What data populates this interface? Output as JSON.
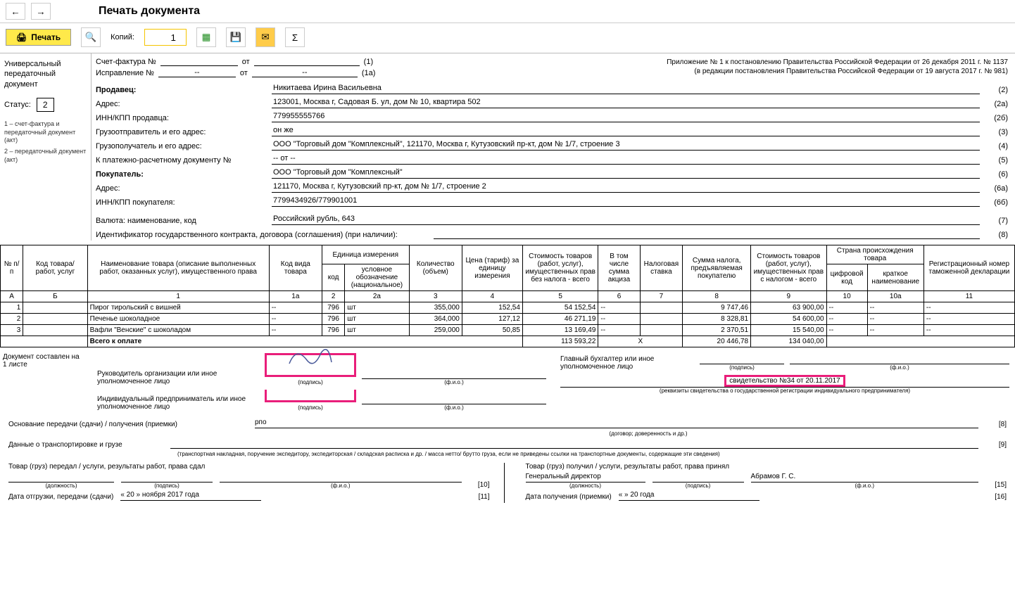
{
  "toolbar": {
    "title": "Печать документа",
    "print_label": "Печать",
    "copies_label": "Копий:",
    "copies_value": "1"
  },
  "sidebar": {
    "line1": "Универсальный",
    "line2": "передаточный",
    "line3": "документ",
    "status_label": "Статус:",
    "status_value": "2",
    "legend1": "1 – счет-фактура и передаточный документ (акт)",
    "legend2": "2 – передаточный документ (акт)"
  },
  "header": {
    "sf_label": "Счет-фактура №",
    "sf_from": "от",
    "sf_code": "(1)",
    "corr_label": "Исправление №",
    "corr_num": "--",
    "corr_from": "от",
    "corr_date": "--",
    "corr_code": "(1а)",
    "appendix1": "Приложение № 1 к постановлению Правительства Российской Федерации от 26 декабря 2011 г. № 1137",
    "appendix2": "(в редакции постановления Правительства Российской Федерации от 19 августа 2017 г. № 981)",
    "fields": [
      {
        "label": "Продавец:",
        "value": "Никитаева Ирина Васильевна",
        "code": "(2)",
        "bold": true
      },
      {
        "label": "Адрес:",
        "value": "123001, Москва г, Садовая Б. ул, дом № 10, квартира 502",
        "code": "(2а)"
      },
      {
        "label": "ИНН/КПП продавца:",
        "value": "779955555766",
        "code": "(2б)"
      },
      {
        "label": "Грузоотправитель и его адрес:",
        "value": "он же",
        "code": "(3)"
      },
      {
        "label": "Грузополучатель и его адрес:",
        "value": "ООО \"Торговый дом \"Комплексный\", 121170, Москва г, Кутузовский пр-кт, дом № 1/7, строение 3",
        "code": "(4)"
      },
      {
        "label": "К платежно-расчетному документу №",
        "value": "-- от --",
        "code": "(5)"
      },
      {
        "label": "Покупатель:",
        "value": "ООО \"Торговый дом \"Комплексный\"",
        "code": "(6)",
        "bold": true
      },
      {
        "label": "Адрес:",
        "value": "121170, Москва г, Кутузовский пр-кт, дом № 1/7, строение 2",
        "code": "(6а)"
      },
      {
        "label": "ИНН/КПП покупателя:",
        "value": "7799434926/779901001",
        "code": "(6б)"
      },
      {
        "label": "Валюта: наименование, код",
        "value": "Российский рубль, 643",
        "code": "(7)",
        "gap": true
      },
      {
        "label": "Идентификатор государственного контракта, договора (соглашения) (при наличии):",
        "value": "",
        "code": "(8)",
        "wide": true
      }
    ]
  },
  "table": {
    "h": {
      "num": "№ п/п",
      "code": "Код товара/ работ, услуг",
      "name": "Наименование товара (описание выполненных работ, оказанных услуг), имущественного права",
      "kind": "Код вида товара",
      "unit": "Единица измерения",
      "ucode": "код",
      "uname": "условное обозначение (национальное)",
      "qty": "Количество (объем)",
      "price": "Цена (тариф) за единицу измерения",
      "cost_notax": "Стоимость товаров (работ, услуг), имущественных прав без налога - всего",
      "excise": "В том числе сумма акциза",
      "rate": "Налоговая ставка",
      "tax": "Сумма налога, предъявляемая покупателю",
      "cost_tax": "Стоимость товаров (работ, услуг), имущественных прав с налогом - всего",
      "country": "Страна происхождения товара",
      "ccode": "цифровой код",
      "cname": "краткое наименование",
      "decl": "Регистрационный номер таможенной декларации",
      "cA": "А",
      "cB": "Б",
      "c1": "1",
      "c1a": "1а",
      "c2": "2",
      "c2a": "2а",
      "c3": "3",
      "c4": "4",
      "c5": "5",
      "c6": "6",
      "c7": "7",
      "c8": "8",
      "c9": "9",
      "c10": "10",
      "c10a": "10а",
      "c11": "11"
    },
    "rows": [
      {
        "n": "1",
        "name": "Пирог тирольский с вишней",
        "kind": "--",
        "uc": "796",
        "un": "шт",
        "qty": "355,000",
        "price": "152,54",
        "cost": "54 152,54",
        "ex": "--",
        "rate": "",
        "tax": "9 747,46",
        "total": "63 900,00",
        "cc": "--",
        "cn": "--",
        "decl": "--"
      },
      {
        "n": "2",
        "name": "Печенье шоколадное",
        "kind": "--",
        "uc": "796",
        "un": "шт",
        "qty": "364,000",
        "price": "127,12",
        "cost": "46 271,19",
        "ex": "--",
        "rate": "",
        "tax": "8 328,81",
        "total": "54 600,00",
        "cc": "--",
        "cn": "--",
        "decl": "--"
      },
      {
        "n": "3",
        "name": "Вафли \"Венские\" с шоколадом",
        "kind": "--",
        "uc": "796",
        "un": "шт",
        "qty": "259,000",
        "price": "50,85",
        "cost": "13 169,49",
        "ex": "--",
        "rate": "",
        "tax": "2 370,51",
        "total": "15 540,00",
        "cc": "--",
        "cn": "--",
        "decl": "--"
      }
    ],
    "total_label": "Всего к оплате",
    "t_cost": "113 593,22",
    "t_x": "Х",
    "t_tax": "20 446,78",
    "t_total": "134 040,00"
  },
  "sign": {
    "doc_on": "Документ составлен на",
    "sheets": "1 листе",
    "head": "Руководитель организации или иное уполномоченное лицо",
    "ip": "Индивидуальный предприниматель или иное уполномоченное лицо",
    "acc": "Главный бухгалтер или иное уполномоченное лицо",
    "cert": "свидетельство №34 от 20.11.2017",
    "podpis": "(подпись)",
    "fio": "(ф.и.о.)",
    "rekv": "(реквизиты свидетельства о государственной регистрации индивидуального предпринимателя)"
  },
  "footer": {
    "basis_lbl": "Основание передачи (сдачи) / получения (приемки)",
    "basis_val": "рпо",
    "basis_code": "[8]",
    "basis_note": "(договор; доверенность и др.)",
    "trans_lbl": "Данные о транспортировке и грузе",
    "trans_code": "[9]",
    "trans_note": "(транспортная накладная, поручение экспедитору, экспедиторская / складская расписка и др. / масса нетто/ брутто груза, если не приведены ссылки на транспортные документы, содержащие эти сведения)",
    "left_title": "Товар (груз) передал / услуги, результаты работ, права сдал",
    "left_code": "[10]",
    "right_title": "Товар (груз) получил / услуги, результаты работ, права принял",
    "right_code": "[15]",
    "right_pos": "Генеральный директор",
    "right_name": "Абрамов Г. С.",
    "pos_note": "(должность)",
    "sig_note": "(подпись)",
    "fio_note": "(ф.и.о.)",
    "left_date_lbl": "Дата отгрузки, передачи (сдачи)",
    "left_date_val": "« 20 »   ноября   2017  года",
    "left_date_code": "[11]",
    "right_date_lbl": "Дата получения (приемки)",
    "right_date_val": "«       »                     20       года",
    "right_date_code": "[16]"
  }
}
